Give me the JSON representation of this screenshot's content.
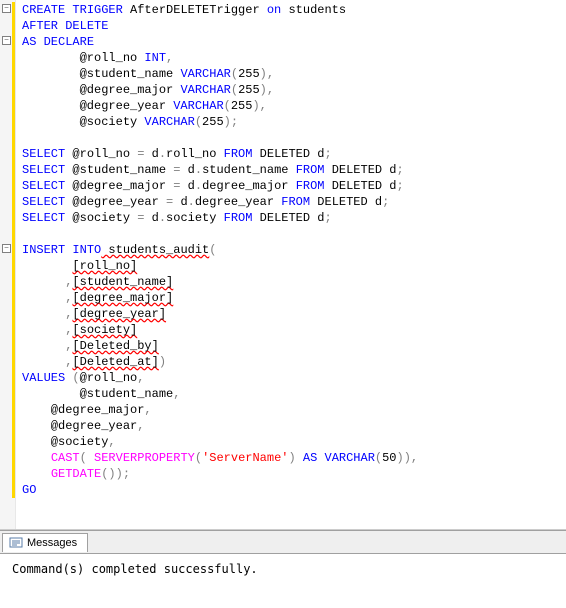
{
  "code": {
    "l1_a": "CREATE",
    "l1_b": " TRIGGER",
    "l1_c": " AfterDELETETrigger ",
    "l1_d": "on",
    "l1_e": " students",
    "l2_a": "AFTER ",
    "l2_b": "DELETE",
    "l3_a": "AS",
    "l3_b": " DECLARE",
    "l4_a": "        @roll_no ",
    "l4_b": "INT",
    "l4_c": ",",
    "l5_a": "        @student_name ",
    "l5_b": "VARCHAR",
    "l5_c": "(",
    "l5_d": "255",
    "l5_e": ")",
    "l5_f": ",",
    "l6_a": "        @degree_major ",
    "l6_b": "VARCHAR",
    "l6_c": "(",
    "l6_d": "255",
    "l6_e": ")",
    "l6_f": ",",
    "l7_a": "        @degree_year ",
    "l7_b": "VARCHAR",
    "l7_c": "(",
    "l7_d": "255",
    "l7_e": ")",
    "l7_f": ",",
    "l8_a": "        @society ",
    "l8_b": "VARCHAR",
    "l8_c": "(",
    "l8_d": "255",
    "l8_e": ");",
    "l9": " ",
    "l10_a": "SELECT",
    "l10_b": " @roll_no ",
    "l10_c": "=",
    "l10_d": " d",
    "l10_e": ".",
    "l10_f": "roll_no ",
    "l10_g": "FROM",
    "l10_h": " DELETED d",
    "l10_i": ";",
    "l11_a": "SELECT",
    "l11_b": " @student_name ",
    "l11_c": "=",
    "l11_d": " d",
    "l11_e": ".",
    "l11_f": "student_name ",
    "l11_g": "FROM",
    "l11_h": " DELETED d",
    "l11_i": ";",
    "l12_a": "SELECT",
    "l12_b": " @degree_major ",
    "l12_c": "=",
    "l12_d": " d",
    "l12_e": ".",
    "l12_f": "degree_major ",
    "l12_g": "FROM",
    "l12_h": " DELETED d",
    "l12_i": ";",
    "l13_a": "SELECT",
    "l13_b": " @degree_year ",
    "l13_c": "=",
    "l13_d": " d",
    "l13_e": ".",
    "l13_f": "degree_year ",
    "l13_g": "FROM",
    "l13_h": " DELETED d",
    "l13_i": ";",
    "l14_a": "SELECT",
    "l14_b": " @society ",
    "l14_c": "=",
    "l14_d": " d",
    "l14_e": ".",
    "l14_f": "society ",
    "l14_g": "FROM",
    "l14_h": " DELETED d",
    "l14_i": ";",
    "l15": " ",
    "l16_a": "INSERT",
    "l16_b": " INTO",
    "l16_c": " students_audit",
    "l16_d": "(",
    "l17_a": "       ",
    "l17_b": "[roll_no]",
    "l18_a": "      ",
    "l18_b": ",",
    "l18_c": "[student_name]",
    "l19_a": "      ",
    "l19_b": ",",
    "l19_c": "[degree_major]",
    "l20_a": "      ",
    "l20_b": ",",
    "l20_c": "[degree_year]",
    "l21_a": "      ",
    "l21_b": ",",
    "l21_c": "[society]",
    "l22_a": "      ",
    "l22_b": ",",
    "l22_c": "[Deleted_by]",
    "l23_a": "      ",
    "l23_b": ",",
    "l23_c": "[Deleted_at]",
    "l23_d": ")",
    "l24_a": "VALUES",
    "l24_b": " (",
    "l24_c": "@roll_no",
    "l24_d": ",",
    "l25_a": "        @student_name",
    "l25_b": ",",
    "l26_a": "    @degree_major",
    "l26_b": ",",
    "l27_a": "    @degree_year",
    "l27_b": ",",
    "l28_a": "    @society",
    "l28_b": ",",
    "l29_a": "    ",
    "l29_b": "CAST",
    "l29_c": "(",
    "l29_d": " SERVERPROPERTY",
    "l29_e": "(",
    "l29_f": "'ServerName'",
    "l29_g": ")",
    "l29_h": " AS",
    "l29_i": " VARCHAR",
    "l29_j": "(",
    "l29_k": "50",
    "l29_l": "))",
    "l29_m": ",",
    "l30_a": "    ",
    "l30_b": "GETDATE",
    "l30_c": "())",
    "l30_d": ";",
    "l31_a": "GO"
  },
  "messages": {
    "tab_label": "Messages",
    "body": "Command(s) completed successfully."
  }
}
